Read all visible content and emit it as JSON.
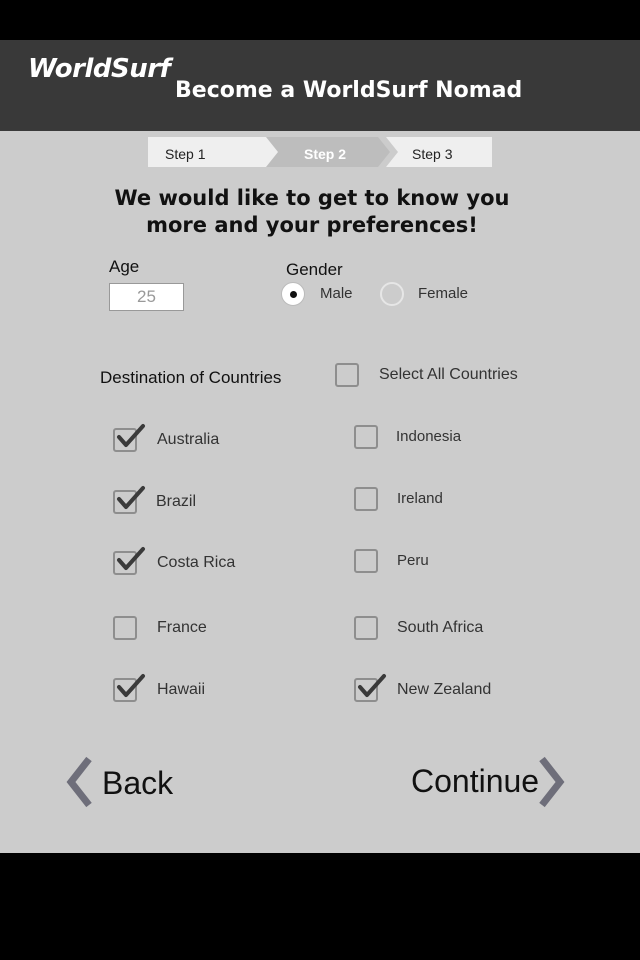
{
  "app": {
    "logo": "WorldSurf",
    "title": "Become a WorldSurf Nomad"
  },
  "steps": [
    {
      "label": "Step 1",
      "active": false
    },
    {
      "label": "Step 2",
      "active": true
    },
    {
      "label": "Step 3",
      "active": false
    }
  ],
  "heading": {
    "line1": "We would like to get to know you",
    "line2": "more and your preferences!"
  },
  "age": {
    "label": "Age",
    "value": "25"
  },
  "gender": {
    "label": "Gender",
    "options": [
      "Male",
      "Female"
    ],
    "selected": "Male"
  },
  "destinations": {
    "label": "Destination of Countries",
    "select_all": {
      "label": "Select All Countries",
      "checked": false
    },
    "countries": [
      {
        "name": "Australia",
        "checked": true
      },
      {
        "name": "Indonesia",
        "checked": false
      },
      {
        "name": "Brazil",
        "checked": true
      },
      {
        "name": "Ireland",
        "checked": false
      },
      {
        "name": "Costa Rica",
        "checked": true
      },
      {
        "name": "Peru",
        "checked": false
      },
      {
        "name": "France",
        "checked": false
      },
      {
        "name": "South Africa",
        "checked": false
      },
      {
        "name": "Hawaii",
        "checked": true
      },
      {
        "name": "New Zealand",
        "checked": true
      }
    ]
  },
  "nav": {
    "back_label": "Back",
    "continue_label": "Continue"
  },
  "colors": {
    "header_bg": "#393939",
    "main_bg": "#cccccc",
    "active_step": "#bdbdbd",
    "chevron": "#6e6e7a"
  }
}
